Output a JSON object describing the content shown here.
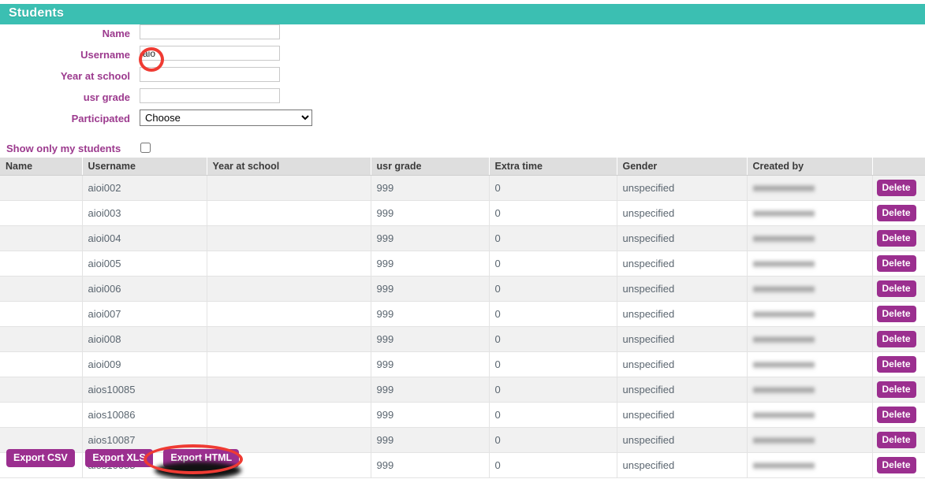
{
  "header": {
    "title": "Students",
    "background_color": "#3bbfb2"
  },
  "theme": {
    "label_purple": "#9c3a8e",
    "button_purple": "#9b2f8f",
    "annotation_red": "#ef3b33",
    "table_header_gray": "#dedede",
    "row_stripe_gray": "#f1f1f1"
  },
  "filter_form": {
    "fields": [
      {
        "label": "Name",
        "type": "text",
        "value": "",
        "placeholder": ""
      },
      {
        "label": "Username",
        "type": "text",
        "value": "aio",
        "placeholder": ""
      },
      {
        "label": "Year at school",
        "type": "text",
        "value": "",
        "placeholder": ""
      },
      {
        "label": "usr grade",
        "type": "text",
        "value": "",
        "placeholder": ""
      }
    ],
    "participated": {
      "label": "Participated",
      "selected": "Choose",
      "options": [
        "Choose"
      ]
    },
    "show_only_my_students": {
      "label": "Show only my students",
      "checked": false
    }
  },
  "table": {
    "columns": [
      "Name",
      "Username",
      "Year at school",
      "usr grade",
      "Extra time",
      "Gender",
      "Created by",
      ""
    ],
    "delete_label": "Delete",
    "created_by_redacted": true,
    "rows": [
      {
        "name": "",
        "username": "aioi002",
        "year_at_school": "",
        "usr_grade": "999",
        "extra_time": "0",
        "gender": "unspecified",
        "created_by": ""
      },
      {
        "name": "",
        "username": "aioi003",
        "year_at_school": "",
        "usr_grade": "999",
        "extra_time": "0",
        "gender": "unspecified",
        "created_by": ""
      },
      {
        "name": "",
        "username": "aioi004",
        "year_at_school": "",
        "usr_grade": "999",
        "extra_time": "0",
        "gender": "unspecified",
        "created_by": ""
      },
      {
        "name": "",
        "username": "aioi005",
        "year_at_school": "",
        "usr_grade": "999",
        "extra_time": "0",
        "gender": "unspecified",
        "created_by": ""
      },
      {
        "name": "",
        "username": "aioi006",
        "year_at_school": "",
        "usr_grade": "999",
        "extra_time": "0",
        "gender": "unspecified",
        "created_by": ""
      },
      {
        "name": "",
        "username": "aioi007",
        "year_at_school": "",
        "usr_grade": "999",
        "extra_time": "0",
        "gender": "unspecified",
        "created_by": ""
      },
      {
        "name": "",
        "username": "aioi008",
        "year_at_school": "",
        "usr_grade": "999",
        "extra_time": "0",
        "gender": "unspecified",
        "created_by": ""
      },
      {
        "name": "",
        "username": "aioi009",
        "year_at_school": "",
        "usr_grade": "999",
        "extra_time": "0",
        "gender": "unspecified",
        "created_by": ""
      },
      {
        "name": "",
        "username": "aios10085",
        "year_at_school": "",
        "usr_grade": "999",
        "extra_time": "0",
        "gender": "unspecified",
        "created_by": ""
      },
      {
        "name": "",
        "username": "aios10086",
        "year_at_school": "",
        "usr_grade": "999",
        "extra_time": "0",
        "gender": "unspecified",
        "created_by": ""
      },
      {
        "name": "",
        "username": "aios10087",
        "year_at_school": "",
        "usr_grade": "999",
        "extra_time": "0",
        "gender": "unspecified",
        "created_by": ""
      },
      {
        "name": "",
        "username": "aios10088",
        "year_at_school": "",
        "usr_grade": "999",
        "extra_time": "0",
        "gender": "unspecified",
        "created_by": ""
      }
    ]
  },
  "export_bar": {
    "buttons": [
      {
        "label": "Export CSV"
      },
      {
        "label": "Export XLS"
      },
      {
        "label": "Export HTML"
      }
    ]
  },
  "annotations": [
    {
      "name": "username-value-highlight",
      "shape": "ellipse",
      "color": "#ef3b33"
    },
    {
      "name": "export-html-highlight",
      "shape": "ellipse",
      "color": "#ef3b33"
    }
  ]
}
